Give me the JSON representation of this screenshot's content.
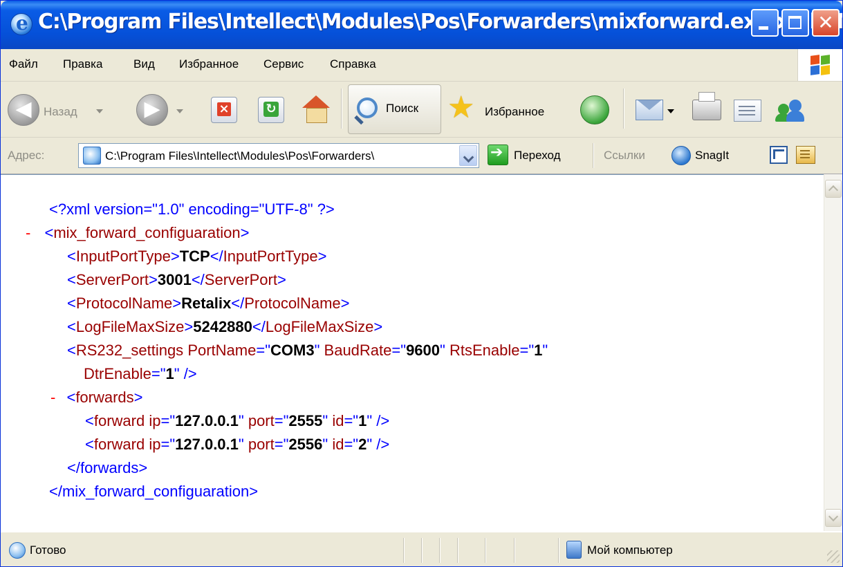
{
  "window": {
    "title": "C:\\Program Files\\Intellect\\Modules\\Pos\\Forwarders\\mixforward.exe.xml - Micr..."
  },
  "menu": {
    "items": [
      "Файл",
      "Правка",
      "Вид",
      "Избранное",
      "Сервис",
      "Справка"
    ]
  },
  "toolbar": {
    "back_label": "Назад",
    "search_label": "Поиск",
    "favorites_label": "Избранное"
  },
  "address": {
    "label": "Адрес:",
    "value": "C:\\Program Files\\Intellect\\Modules\\Pos\\Forwarders\\",
    "go_label": "Переход",
    "links_label": "Ссылки",
    "snagit_label": "SnagIt"
  },
  "xml": {
    "decl": "<?xml version=\"1.0\" encoding=\"UTF-8\" ?>",
    "root_open": "<mix_forward_configuaration>",
    "input_port_type": "TCP",
    "server_port": "3001",
    "protocol_name": "Retalix",
    "log_file_max_size": "5242880",
    "rs232": {
      "port_name": "COM3",
      "baud_rate": "9600",
      "rts_enable": "1",
      "dtr_enable": "1"
    },
    "forwards": [
      {
        "ip": "127.0.0.1",
        "port": "2555",
        "id": "1"
      },
      {
        "ip": "127.0.0.1",
        "port": "2556",
        "id": "2"
      }
    ],
    "forwards_close": "</forwards>",
    "root_close": "</mix_forward_configuaration>"
  },
  "status": {
    "text": "Готово",
    "zone": "Мой компьютер"
  },
  "colors": {
    "titlebar": "#0a5ce6",
    "markup_blue": "#0000ff",
    "tag_red": "#990000",
    "collapse_minus": "#ff0000"
  }
}
